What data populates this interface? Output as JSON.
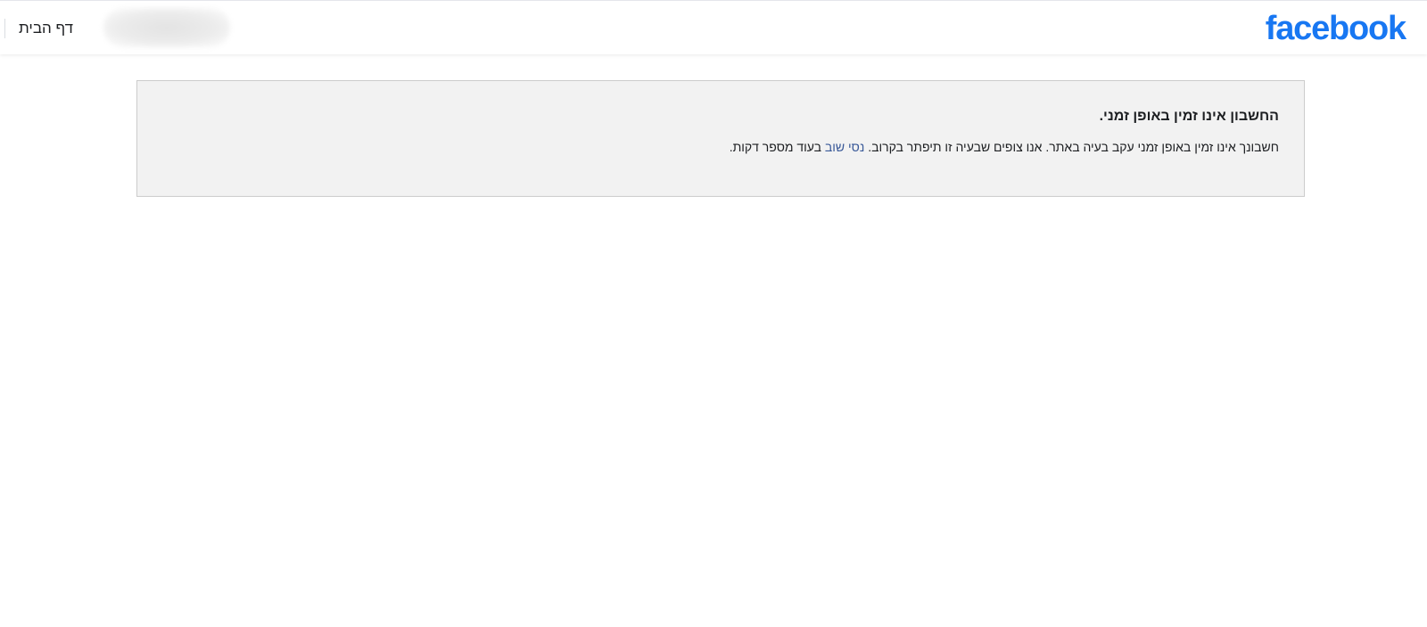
{
  "header": {
    "logo_text": "facebook",
    "home_link": "דף הבית",
    "brand_color": "#1877f2"
  },
  "notice": {
    "title": "החשבון אינו זמין באופן זמני.",
    "body_part1": "חשבונך אינו זמין באופן זמני עקב בעיה באתר. אנו צופים שבעיה זו תיפתר בקרוב.",
    "retry_link": "נסי שוב",
    "body_part2": "בעוד מספר דקות.",
    "link_color": "#385898",
    "background_color": "#f2f2f2"
  }
}
